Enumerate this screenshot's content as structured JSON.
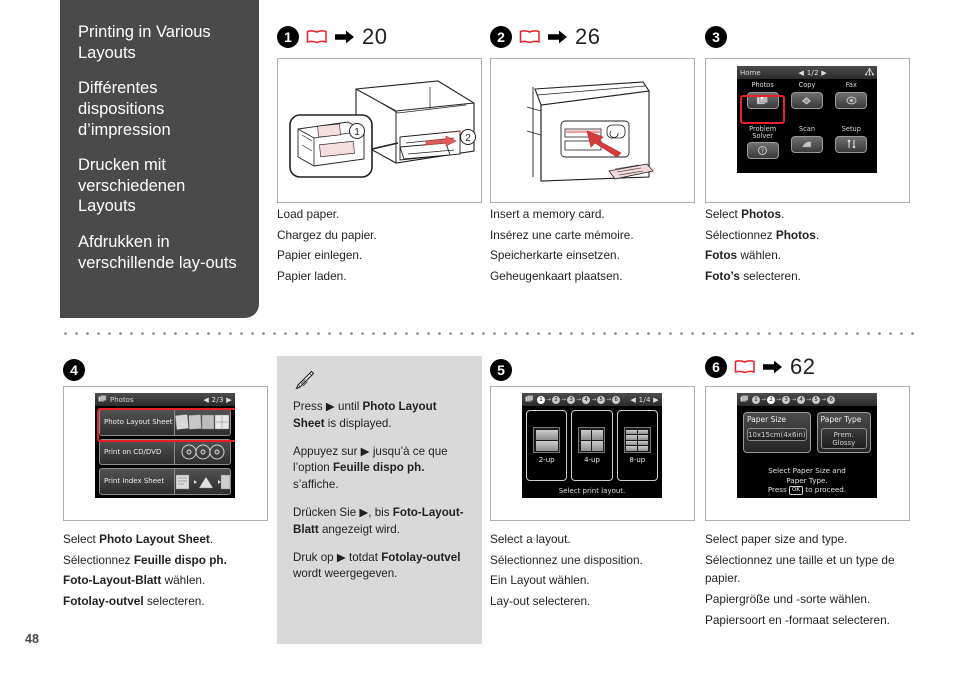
{
  "page_number": "48",
  "sidebar": {
    "titles": [
      "Printing in Various Layouts",
      "Différentes dispositions d’impression",
      "Drucken mit verschiedenen Layouts",
      "Afdrukken in verschillende lay-outs"
    ]
  },
  "steps": [
    {
      "number": "1",
      "icon": "book-icon",
      "arrow": "right-arrow-icon",
      "ref": "20",
      "illustration": "printer-load-paper-cassette-diagram",
      "callouts": [
        "1",
        "2"
      ],
      "captions": [
        {
          "en": "Load paper."
        },
        {
          "fr": "Chargez du papier."
        },
        {
          "de": "Papier einlegen."
        },
        {
          "nl": "Papier laden."
        }
      ]
    },
    {
      "number": "2",
      "icon": "book-icon",
      "arrow": "right-arrow-icon",
      "ref": "26",
      "illustration": "memory-card-slot-insert-diagram",
      "captions": [
        {
          "en": "Insert a memory card."
        },
        {
          "fr": "Insérez une carte mémoire."
        },
        {
          "de": "Speicherkarte einsetzen."
        },
        {
          "nl": "Geheugenkaart plaatsen."
        }
      ]
    },
    {
      "number": "3",
      "illustration": "lcd-home-menu",
      "captions": [
        {
          "pre": "Select ",
          "bold": "Photos",
          "post": "."
        },
        {
          "pre": "Sélectionnez ",
          "bold": "Photos",
          "post": "."
        },
        {
          "pre": "",
          "bold": "Fotos",
          "post": " wählen."
        },
        {
          "pre": "",
          "bold": "Foto’s",
          "post": " selecteren."
        }
      ]
    },
    {
      "number": "4",
      "illustration": "lcd-photos-menu",
      "captions": [
        {
          "pre": "Select ",
          "bold": "Photo Layout Sheet",
          "post": "."
        },
        {
          "pre": "Sélectionnez ",
          "bold": "Feuille dispo ph.",
          "post": ""
        },
        {
          "pre": "",
          "bold": "Foto-Layout-Blatt",
          "post": " wählen."
        },
        {
          "pre": "",
          "bold": "Fotolay-outvel",
          "post": " selecteren."
        }
      ]
    },
    {
      "number": "5",
      "illustration": "lcd-layout-select",
      "captions": [
        {
          "en": "Select a layout."
        },
        {
          "fr": "Sélectionnez une disposition."
        },
        {
          "de": "Ein Layout wählen."
        },
        {
          "nl": "Lay-out selecteren."
        }
      ]
    },
    {
      "number": "6",
      "icon": "book-icon",
      "arrow": "right-arrow-icon",
      "ref": "62",
      "illustration": "lcd-paper-settings",
      "captions": [
        {
          "en": "Select paper size and type."
        },
        {
          "fr": "Sélectionnez une taille et un type de papier."
        },
        {
          "de": "Papiergröße und -sorte wählen."
        },
        {
          "nl": "Papiersoort en -formaat selecteren."
        }
      ]
    }
  ],
  "note": {
    "icon": "pencil-icon",
    "lines": [
      {
        "pre": "Press ",
        "tri": "▶",
        "mid": " until ",
        "bold": "Photo Layout Sheet",
        "post": " is displayed."
      },
      {
        "pre": "Appuyez sur ",
        "tri": "▶",
        "mid": " jusqu’à ce que l’option ",
        "bold": "Feuille dispo ph.",
        "post": " s’affiche."
      },
      {
        "pre": "Drücken Sie ",
        "tri": "▶",
        "mid": ", bis ",
        "bold": "Foto-Layout-Blatt",
        "post": " angezeigt wird."
      },
      {
        "pre": "Druk op ",
        "tri": "▶",
        "mid": " totdat ",
        "bold": "Fotolay-outvel",
        "post": " wordt weergegeven."
      }
    ]
  },
  "lcd_home": {
    "title": "Home",
    "pager": "◀ 1/2 ▶",
    "network_icon": "network-icon",
    "items": [
      {
        "label": "Photos",
        "icon": "photos-icon",
        "selected": true
      },
      {
        "label": "Copy",
        "icon": "copy-icon",
        "selected": false
      },
      {
        "label": "Fax",
        "icon": "fax-icon",
        "selected": false
      },
      {
        "label": "Problem Solver",
        "icon": "question-icon",
        "selected": false
      },
      {
        "label": "Scan",
        "icon": "scan-icon",
        "selected": false
      },
      {
        "label": "Setup",
        "icon": "tools-icon",
        "selected": false
      }
    ]
  },
  "lcd_photos": {
    "title": "Photos",
    "title_icon": "photos-icon",
    "pager": "◀ 2/3 ▶",
    "items": [
      {
        "label": "Photo Layout Sheet",
        "selected": true
      },
      {
        "label": "Print on CD/DVD",
        "selected": false
      },
      {
        "label": "Print Index Sheet",
        "selected": false
      }
    ]
  },
  "lcd_layout": {
    "title_icon": "photos-icon",
    "breadcrumb": [
      "1",
      "2",
      "3",
      "4",
      "5",
      "6"
    ],
    "breadcrumb_active": "1",
    "pager": "◀ 1/4 ▶",
    "options": [
      {
        "label": "2-up",
        "cells": 2
      },
      {
        "label": "4-up",
        "cells": 4
      },
      {
        "label": "8-up",
        "cells": 8
      }
    ],
    "footer": "Select print layout."
  },
  "lcd_paper": {
    "title_icon": "photos-icon",
    "breadcrumb": [
      "1",
      "2",
      "3",
      "4",
      "5",
      "6"
    ],
    "breadcrumb_active": "2",
    "fields": [
      {
        "key": "Paper Size",
        "value": "10x15cm(4x6in)"
      },
      {
        "key": "Paper Type",
        "value": "Prem. Glossy"
      }
    ],
    "footer_line1": "Select Paper Size and",
    "footer_line2": "Paper Type.",
    "footer_line3_pre": "Press ",
    "footer_key": "OK",
    "footer_line3_post": " to proceed."
  },
  "colors": {
    "sidebar_bg": "#4a4a4a",
    "note_bg": "#d9d9d9",
    "highlight_red": "#e8202a",
    "text": "#231f20"
  }
}
